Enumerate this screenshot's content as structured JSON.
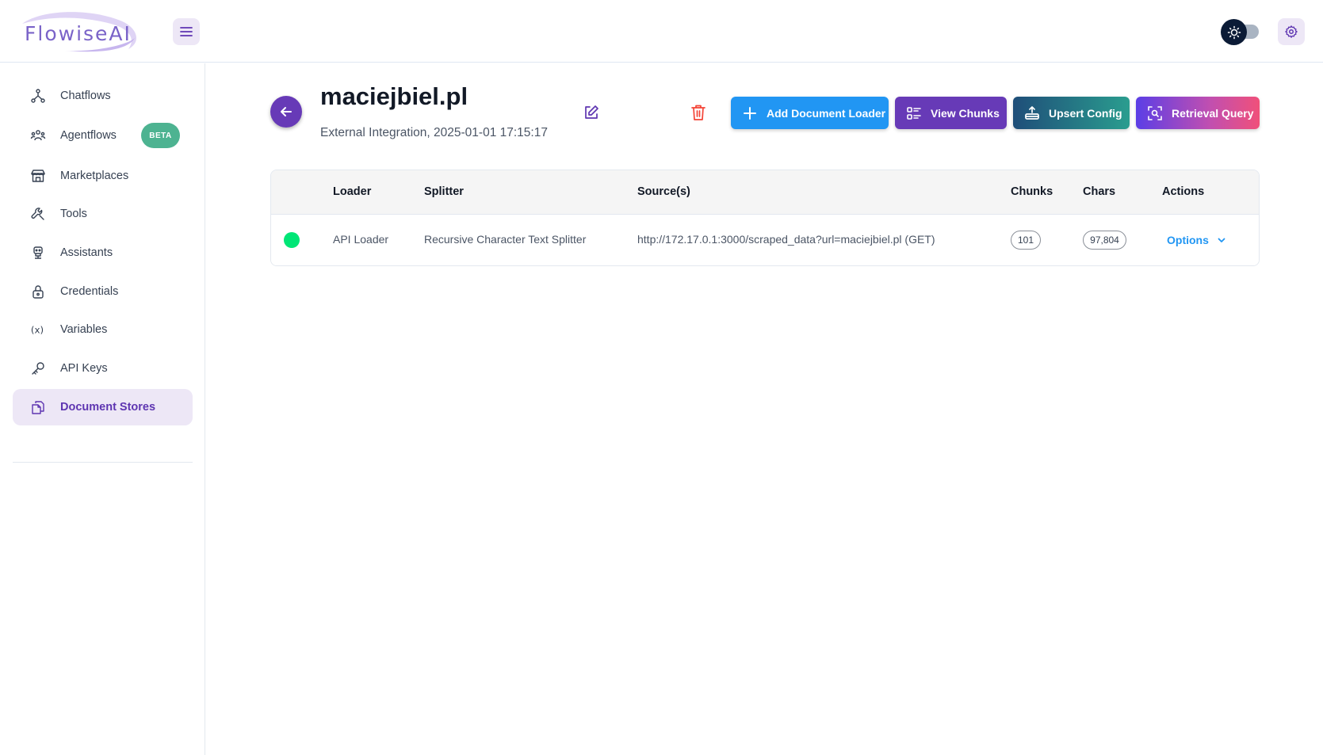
{
  "header": {
    "logo_text": "FlowiseAI"
  },
  "sidebar": {
    "items": [
      {
        "label": "Chatflows",
        "icon": "chatflows-icon"
      },
      {
        "label": "Agentflows",
        "icon": "agentflows-icon",
        "badge": "BETA"
      },
      {
        "label": "Marketplaces",
        "icon": "marketplace-icon"
      },
      {
        "label": "Tools",
        "icon": "tools-icon"
      },
      {
        "label": "Assistants",
        "icon": "assistant-icon"
      },
      {
        "label": "Credentials",
        "icon": "lock-icon"
      },
      {
        "label": "Variables",
        "icon": "variables-icon"
      },
      {
        "label": "API Keys",
        "icon": "key-icon"
      },
      {
        "label": "Document Stores",
        "icon": "document-stores-icon",
        "active": true
      }
    ]
  },
  "store": {
    "title": "maciejbiel.pl",
    "subtitle": "External Integration, 2025-01-01 17:15:17"
  },
  "actions": {
    "add_loader": "Add Document Loader",
    "view_chunks": "View Chunks",
    "upsert_config": "Upsert Config",
    "retrieval_query": "Retrieval Query"
  },
  "table": {
    "columns": {
      "loader": "Loader",
      "splitter": "Splitter",
      "sources": "Source(s)",
      "chunks": "Chunks",
      "chars": "Chars",
      "actions": "Actions"
    },
    "rows": [
      {
        "status_color": "#00e676",
        "loader": "API Loader",
        "splitter": "Recursive Character Text Splitter",
        "source": "http://172.17.0.1:3000/scraped_data?url=maciejbiel.pl (GET)",
        "chunks": "101",
        "chars": "97,804",
        "options_label": "Options"
      }
    ]
  },
  "colors": {
    "accent": "#673ab7",
    "primary": "#2196f3",
    "danger": "#f44336",
    "active_bg": "#ede7f6"
  }
}
